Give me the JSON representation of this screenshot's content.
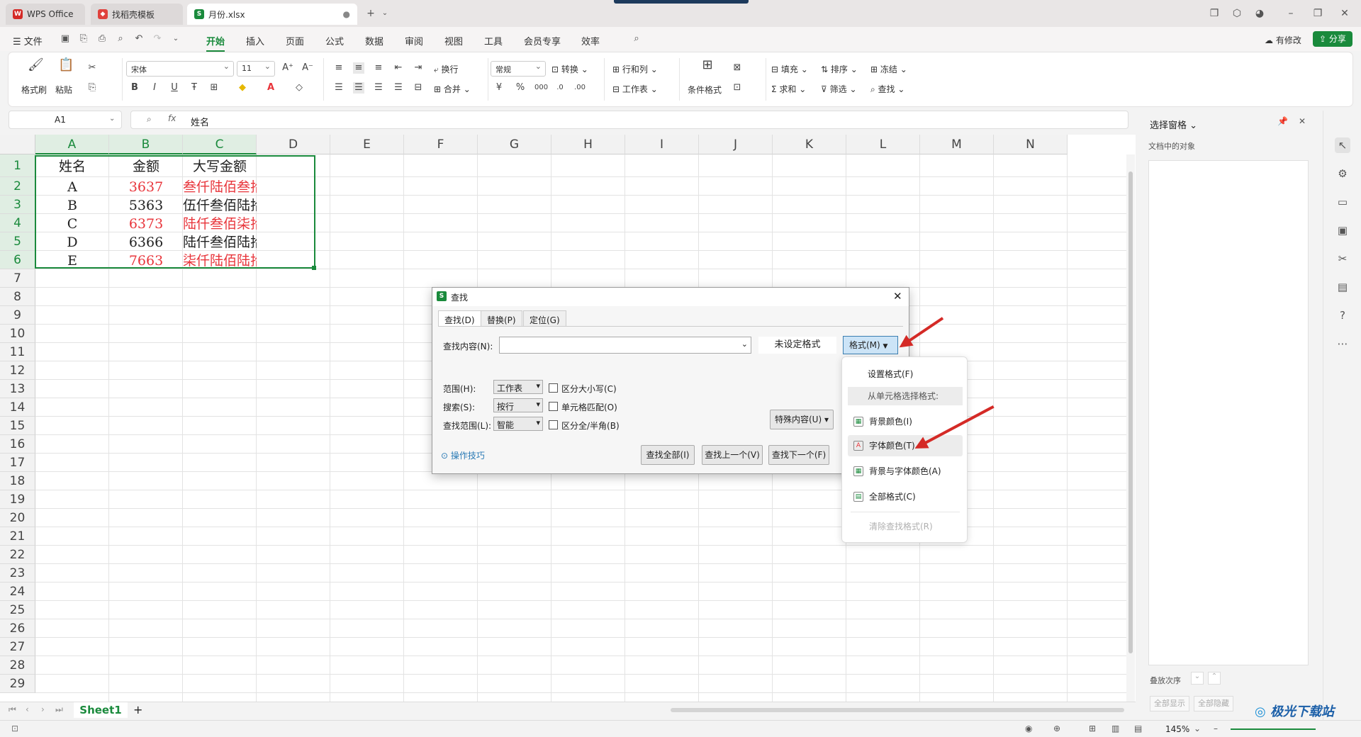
{
  "tabs": [
    {
      "label": "WPS Office"
    },
    {
      "label": "找稻壳模板"
    },
    {
      "label": "月份.xlsx"
    }
  ],
  "menu": {
    "file": "文件",
    "items": [
      "开始",
      "插入",
      "页面",
      "公式",
      "数据",
      "审阅",
      "视图",
      "工具",
      "会员专享",
      "效率"
    ],
    "active": "开始",
    "has_changes": "有修改",
    "share": "分享"
  },
  "ribbon": {
    "format_painter": "格式刷",
    "paste": "粘贴",
    "font_name": "宋体",
    "font_size": "11",
    "wrap": "换行",
    "merge": "合并",
    "number_format": "常规",
    "convert": "转换",
    "row_col": "行和列",
    "worksheet": "工作表",
    "cond_format": "条件格式",
    "fill": "填充",
    "sort": "排序",
    "freeze": "冻结",
    "sum": "求和",
    "filter": "筛选",
    "find": "查找",
    "accent": "#1a8a3c"
  },
  "formula_bar": {
    "cell_ref": "A1",
    "content": "姓名"
  },
  "columns": [
    "A",
    "B",
    "C",
    "D",
    "E",
    "F",
    "G",
    "H",
    "I",
    "J",
    "K",
    "L",
    "M",
    "N"
  ],
  "rows": [
    "1",
    "2",
    "3",
    "4",
    "5",
    "6",
    "7",
    "8",
    "9",
    "10",
    "11",
    "12",
    "13",
    "14",
    "15",
    "16",
    "17",
    "18",
    "19",
    "20",
    "21",
    "22",
    "23",
    "24",
    "25",
    "26",
    "27",
    "28",
    "29"
  ],
  "table": {
    "headers": [
      "姓名",
      "金额",
      "大写金额"
    ],
    "rows": [
      {
        "name": "A",
        "amount": "3637",
        "upper": "叁仟陆佰叁拾柒",
        "red": true
      },
      {
        "name": "B",
        "amount": "5363",
        "upper": "伍仟叁佰陆拾叁",
        "red": false
      },
      {
        "name": "C",
        "amount": "6373",
        "upper": "陆仟叁佰柒拾叁",
        "red": true
      },
      {
        "name": "D",
        "amount": "6366",
        "upper": "陆仟叁佰陆拾陆",
        "red": false
      },
      {
        "name": "E",
        "amount": "7663",
        "upper": "柒仟陆佰陆拾叁",
        "red": true
      }
    ]
  },
  "sheet_tab": "Sheet1",
  "zoom": "145%",
  "pane": {
    "title": "选择窗格",
    "subtitle": "文档中的对象",
    "order": "叠放次序",
    "show_all": "全部显示",
    "hide_all": "全部隐藏"
  },
  "dialog": {
    "title": "查找",
    "tabs": [
      "查找(D)",
      "替换(P)",
      "定位(G)"
    ],
    "find_label": "查找内容(N):",
    "find_value": "",
    "no_format": "未设定格式",
    "format_btn": "格式(M)",
    "scope_label": "范围(H):",
    "scope_value": "工作表",
    "search_label": "搜索(S):",
    "search_value": "按行",
    "lookin_label": "查找范围(L):",
    "lookin_value": "智能",
    "match_case": "区分大小写(C)",
    "match_cell": "单元格匹配(O)",
    "match_width": "区分全/半角(B)",
    "special": "特殊内容(U)",
    "tips": "操作技巧",
    "find_all": "查找全部(I)",
    "find_prev": "查找上一个(V)",
    "find_next": "查找下一个(F)"
  },
  "format_menu": {
    "set_format": "设置格式(F)",
    "from_cell": "从单元格选择格式:",
    "bg_color": "背景颜色(I)",
    "font_color": "字体颜色(T)",
    "bg_font_color": "背景与字体颜色(A)",
    "all_format": "全部格式(C)",
    "clear": "清除查找格式(R)"
  },
  "watermark": "极光下载站"
}
